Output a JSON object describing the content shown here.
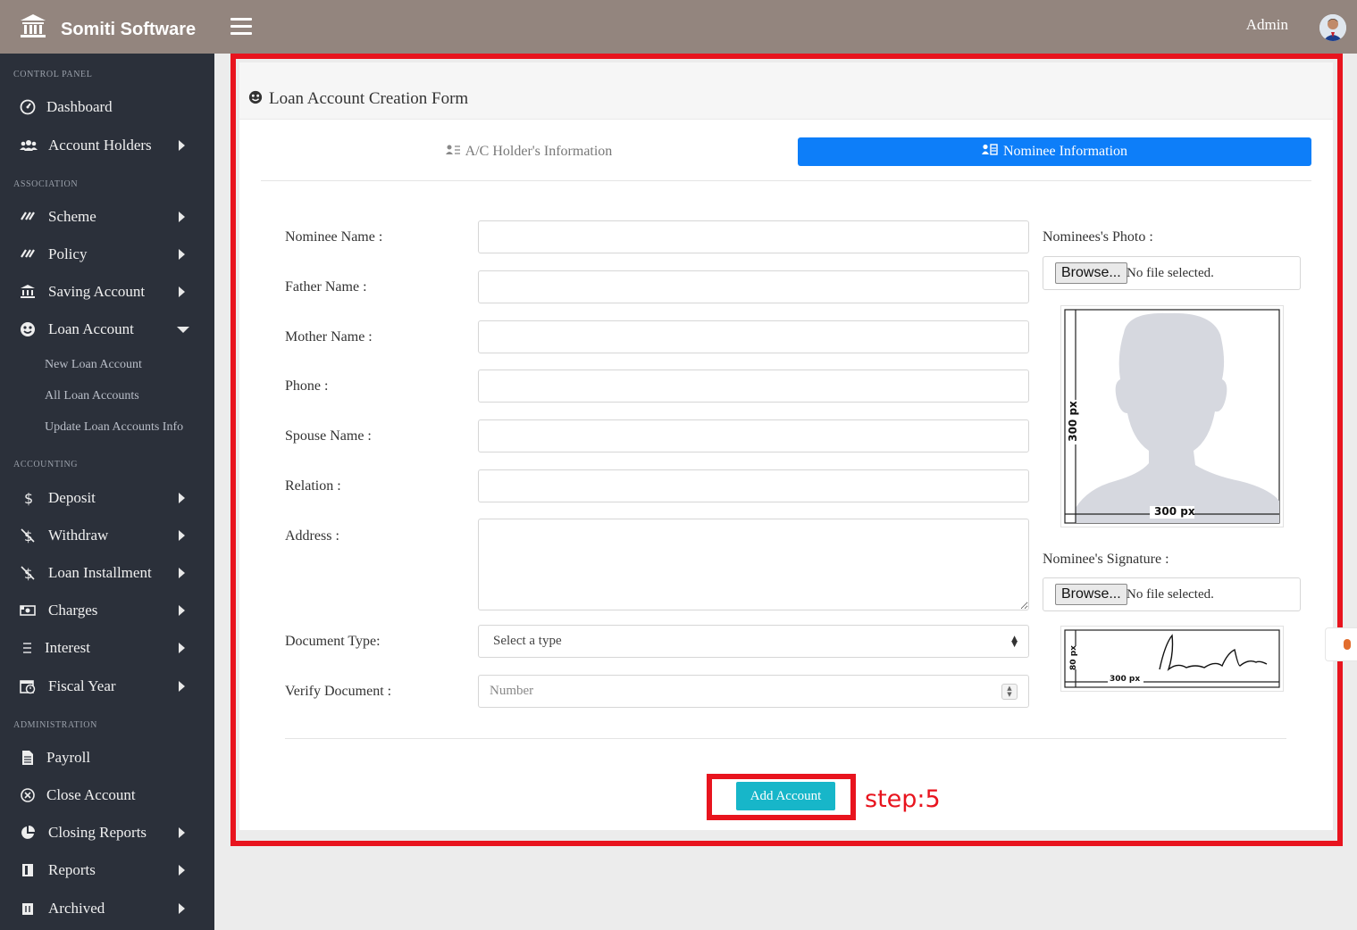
{
  "header": {
    "brand": "Somiti Software",
    "user": "Admin"
  },
  "sidebar": {
    "sections": {
      "control_panel": "CONTROL PANEL",
      "association": "ASSOCIATION",
      "accounting": "ACCOUNTING",
      "administration": "ADMINISTRATION"
    },
    "items": {
      "dashboard": "Dashboard",
      "account_holders": "Account Holders",
      "scheme": "Scheme",
      "policy": "Policy",
      "saving_account": "Saving Account",
      "loan_account": "Loan Account",
      "deposit": "Deposit",
      "withdraw": "Withdraw",
      "loan_installment": "Loan Installment",
      "charges": "Charges",
      "interest": "Interest",
      "fiscal_year": "Fiscal Year",
      "payroll": "Payroll",
      "close_account": "Close Account",
      "closing_reports": "Closing Reports",
      "reports": "Reports",
      "archived": "Archived"
    },
    "loan_sub": {
      "new": "New Loan Account",
      "all": "All Loan Accounts",
      "update": "Update Loan Accounts Info"
    }
  },
  "form": {
    "title": "Loan Account Creation Form",
    "tabs": {
      "holder": "A/C Holder's Information",
      "nominee": "Nominee Information"
    },
    "labels": {
      "nominee_name": "Nominee Name :",
      "father_name": "Father Name :",
      "mother_name": "Mother Name :",
      "phone": "Phone :",
      "spouse_name": "Spouse Name :",
      "relation": "Relation :",
      "address": "Address :",
      "document_type": "Document Type:",
      "verify_document": "Verify Document :"
    },
    "document_type_value": "Select a type",
    "verify_placeholder": "Number",
    "photo_label": "Nominees's Photo :",
    "signature_label": "Nominee's Signature :",
    "browse": "Browse...",
    "no_file": "No file selected.",
    "photo_dim_h": "300 px",
    "photo_dim_v": "300 px",
    "sig_dim_h": "300 px",
    "sig_dim_v": "80 px",
    "submit": "Add Account"
  },
  "annotation": {
    "step": "step:5"
  },
  "colors": {
    "topbar": "#93857e",
    "sidebar": "#2b303a",
    "active_tab": "#0d7ef9",
    "submit": "#17b6c9",
    "highlight": "#e8141e"
  }
}
